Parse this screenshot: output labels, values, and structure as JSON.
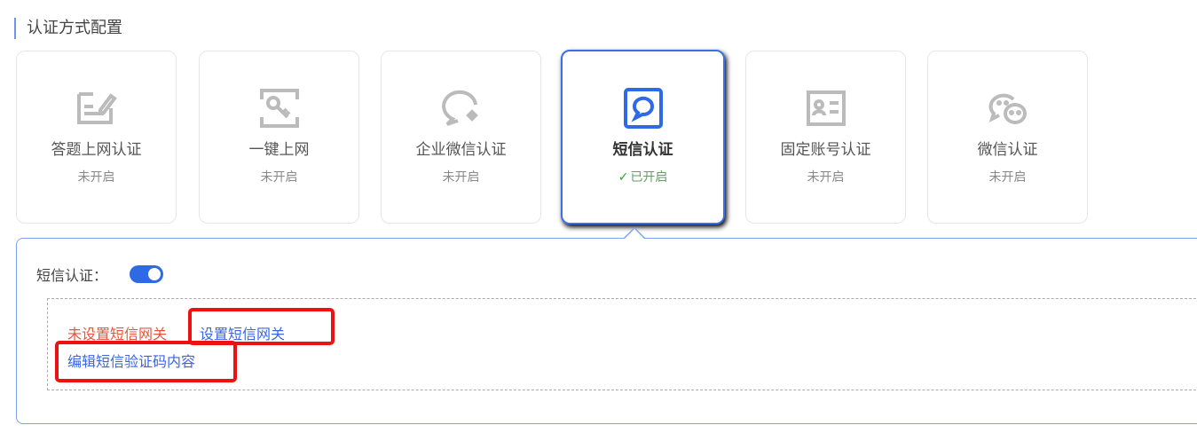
{
  "section_title": "认证方式配置",
  "cards": [
    {
      "name": "答题上网认证",
      "status": "未开启",
      "icon": "edit-form-icon"
    },
    {
      "name": "一键上网",
      "status": "未开启",
      "icon": "key-icon"
    },
    {
      "name": "企业微信认证",
      "status": "未开启",
      "icon": "wecom-icon"
    },
    {
      "name": "短信认证",
      "status": "已开启",
      "icon": "sms-chat-icon",
      "selected": true
    },
    {
      "name": "固定账号认证",
      "status": "未开启",
      "icon": "id-card-icon"
    },
    {
      "name": "微信认证",
      "status": "未开启",
      "icon": "wechat-icon"
    }
  ],
  "panel": {
    "label": "短信认证：",
    "toggle_on": true,
    "warning": "未设置短信网关",
    "set_gateway": "设置短信网关",
    "edit_content": "编辑短信验证码内容"
  },
  "colors": {
    "accent": "#2f6ae6",
    "warning": "#e8553a",
    "highlight": "#ee1111"
  }
}
